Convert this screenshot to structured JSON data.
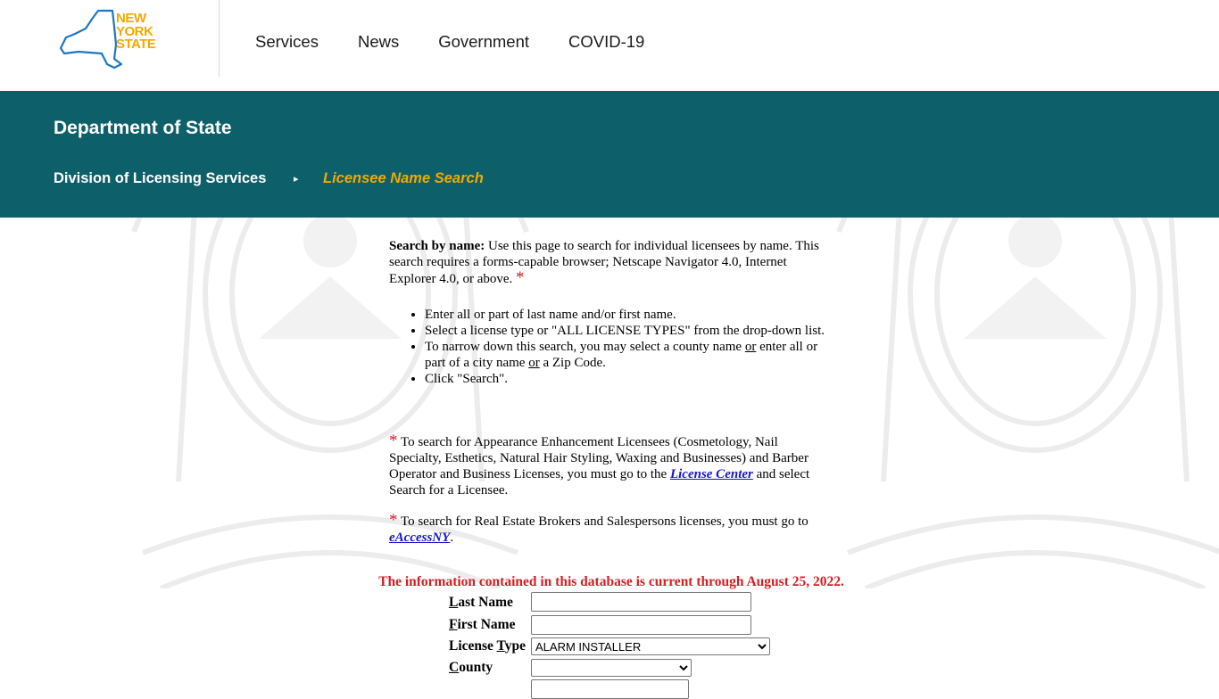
{
  "logo": {
    "line1": "NEW",
    "line2": "YORK",
    "line3": "STATE"
  },
  "nav": [
    "Services",
    "News",
    "Government",
    "COVID-19"
  ],
  "banner": {
    "title": "Department of State",
    "breadcrumb_parent": "Division of Licensing Services",
    "breadcrumb_sep": "▸",
    "breadcrumb_current": "Licensee Name Search"
  },
  "intro": {
    "lead": "Search by name:",
    "text": " Use this page to search for individual licensees by name. This search requires a forms-capable browser; Netscape Navigator 4.0, Internet Explorer 4.0, or above. ",
    "star": "*"
  },
  "steps": {
    "s1": "Enter all or part of last name and/or first name.",
    "s2": "Select a license type or \"ALL LICENSE TYPES\" from the drop-down list.",
    "s3a": "To narrow down this search, you may select a county name ",
    "s3or1": "or",
    "s3b": " enter all or part of a city name ",
    "s3or2": "or",
    "s3c": " a Zip Code.",
    "s4": "Click \"Search\"."
  },
  "note1": {
    "star": "*",
    "text": " To search for Appearance Enhancement Licensees (Cosmetology, Nail Specialty, Esthetics, Natural Hair Styling, Waxing and Businesses) and Barber Operator and Business Licenses, you must go to the ",
    "link": "License Center",
    "tail": " and select Search for a Licensee."
  },
  "note2": {
    "star": "*",
    "text": " To search for Real Estate Brokers and Salespersons licenses, you must go to ",
    "link": "eAccessNY",
    "tail": "."
  },
  "current_notice": "The information contained in this database is current through August 25, 2022.",
  "form": {
    "last_name_key": "L",
    "last_name_rest": "ast Name",
    "last_name_value": "",
    "first_name_key": "F",
    "first_name_rest": "irst Name",
    "first_name_value": "",
    "license_type_pre": "License ",
    "license_type_key": "T",
    "license_type_rest": "ype",
    "license_type_selected": "ALARM INSTALLER",
    "county_key": "C",
    "county_rest": "ounty",
    "county_selected": ""
  },
  "colors": {
    "teal": "#0d5f69",
    "gold": "#f2a900",
    "red": "#d41e24",
    "link": "#1515c8"
  }
}
